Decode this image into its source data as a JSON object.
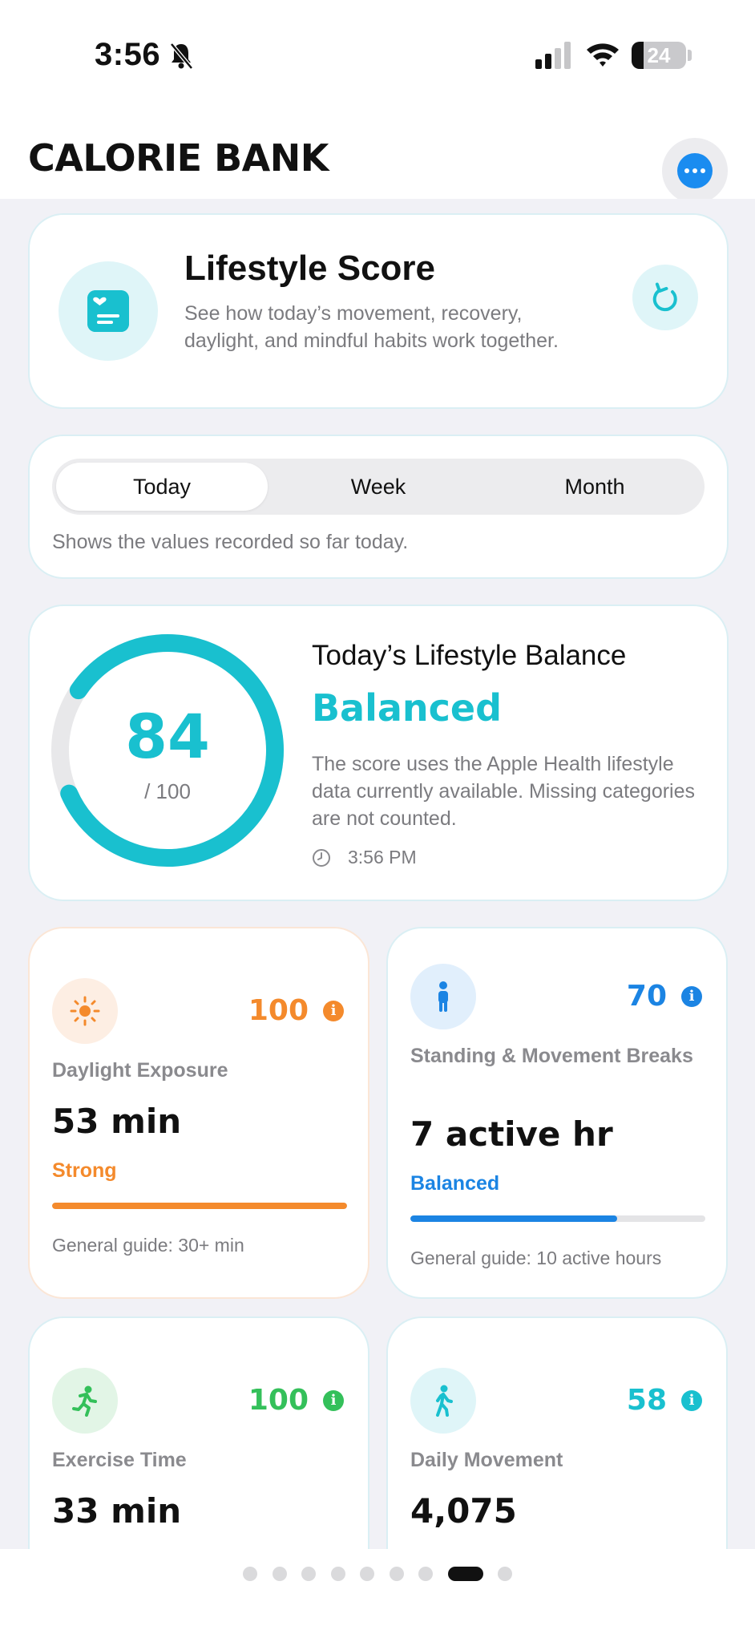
{
  "status_bar": {
    "time": "3:56",
    "battery": "24"
  },
  "header": {
    "title": "CALORIE BANK"
  },
  "lifestyle_card": {
    "title": "Lifestyle Score",
    "description": "See how today’s movement, recovery, daylight, and mindful habits work together."
  },
  "period": {
    "tabs": [
      "Today",
      "Week",
      "Month"
    ],
    "selected": "Today",
    "note": "Shows the values recorded so far today."
  },
  "score": {
    "value": "84",
    "max_label": "/ 100",
    "progress": 0.84,
    "title": "Today’s Lifestyle Balance",
    "status": "Balanced",
    "description": "The score uses the Apple Health lifestyle data currently available. Missing categories are not counted.",
    "time": "3:56 PM",
    "accent": "#19C0CF"
  },
  "metrics": [
    {
      "name": "Daylight Exposure",
      "score": "100",
      "value": "53 min",
      "status": "Strong",
      "progress": 1.0,
      "guide": "General guide: 30+ min",
      "color": "#F48A2C",
      "icon": "sun-icon"
    },
    {
      "name": "Standing & Movement Breaks",
      "score": "70",
      "value": "7 active hr",
      "status": "Balanced",
      "progress": 0.7,
      "guide": "General guide: 10 active hours",
      "color": "#1B84E3",
      "icon": "standing-person-icon"
    },
    {
      "name": "Exercise Time",
      "score": "100",
      "value": "33 min",
      "color": "#34C05A",
      "icon": "running-person-icon"
    },
    {
      "name": "Daily Movement",
      "score": "58",
      "value": "4,075",
      "color": "#19C0CF",
      "icon": "walking-person-icon"
    }
  ],
  "pager": {
    "count": 9,
    "active_index": 7
  }
}
